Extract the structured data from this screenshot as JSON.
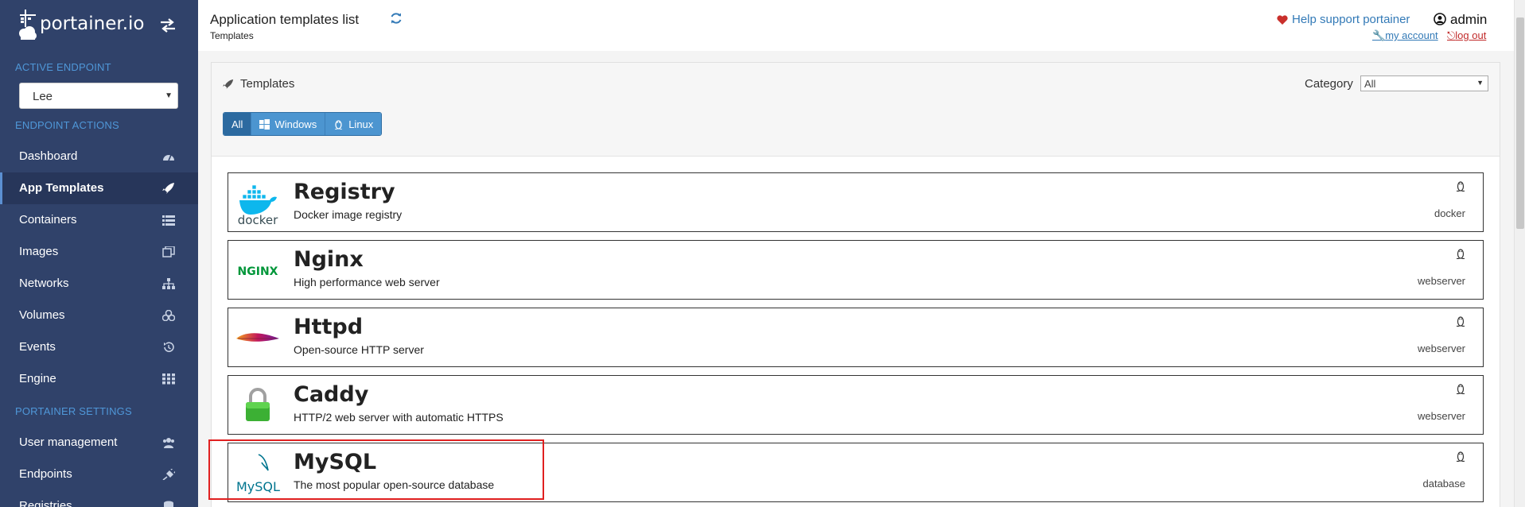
{
  "brand": {
    "name": "portainer.io"
  },
  "sidebar": {
    "active_endpoint_title": "ACTIVE ENDPOINT",
    "endpoint_value": "Lee",
    "endpoint_actions_title": "ENDPOINT ACTIONS",
    "portainer_settings_title": "PORTAINER SETTINGS",
    "items": [
      {
        "label": "Dashboard",
        "icon": "dashboard-icon"
      },
      {
        "label": "App Templates",
        "icon": "rocket-icon"
      },
      {
        "label": "Containers",
        "icon": "list-icon"
      },
      {
        "label": "Images",
        "icon": "clone-icon"
      },
      {
        "label": "Networks",
        "icon": "sitemap-icon"
      },
      {
        "label": "Volumes",
        "icon": "cubes-icon"
      },
      {
        "label": "Events",
        "icon": "history-icon"
      },
      {
        "label": "Engine",
        "icon": "grid-icon"
      }
    ],
    "settings_items": [
      {
        "label": "User management",
        "icon": "users-icon"
      },
      {
        "label": "Endpoints",
        "icon": "plug-icon"
      },
      {
        "label": "Registries",
        "icon": "database-icon"
      }
    ]
  },
  "header": {
    "title": "Application templates list",
    "breadcrumb": "Templates",
    "help_link": "Help support portainer",
    "username": "admin",
    "my_account": "my account",
    "log_out": "log out"
  },
  "panel": {
    "title": "Templates",
    "category_label": "Category",
    "category_value": "All",
    "filters": [
      "All",
      "Windows",
      "Linux"
    ],
    "active_filter": "All"
  },
  "templates": [
    {
      "title": "Registry",
      "description": "Docker image registry",
      "category": "docker",
      "logo": "docker-logo",
      "platform": "linux-icon"
    },
    {
      "title": "Nginx",
      "description": "High performance web server",
      "category": "webserver",
      "logo": "nginx-logo",
      "platform": "linux-icon"
    },
    {
      "title": "Httpd",
      "description": "Open-source HTTP server",
      "category": "webserver",
      "logo": "apache-feather-logo",
      "platform": "linux-icon"
    },
    {
      "title": "Caddy",
      "description": "HTTP/2 web server with automatic HTTPS",
      "category": "webserver",
      "logo": "padlock-logo",
      "platform": "linux-icon"
    },
    {
      "title": "MySQL",
      "description": "The most popular open-source database",
      "category": "database",
      "logo": "mysql-logo",
      "platform": "linux-icon"
    }
  ],
  "logo_text": {
    "docker": "docker",
    "nginx": "NGINX",
    "mysql": "MySQL"
  },
  "colors": {
    "sidebar": "#30426a",
    "accent": "#4f97d8",
    "button": "#4c95d0",
    "highlight": "#e02020"
  }
}
